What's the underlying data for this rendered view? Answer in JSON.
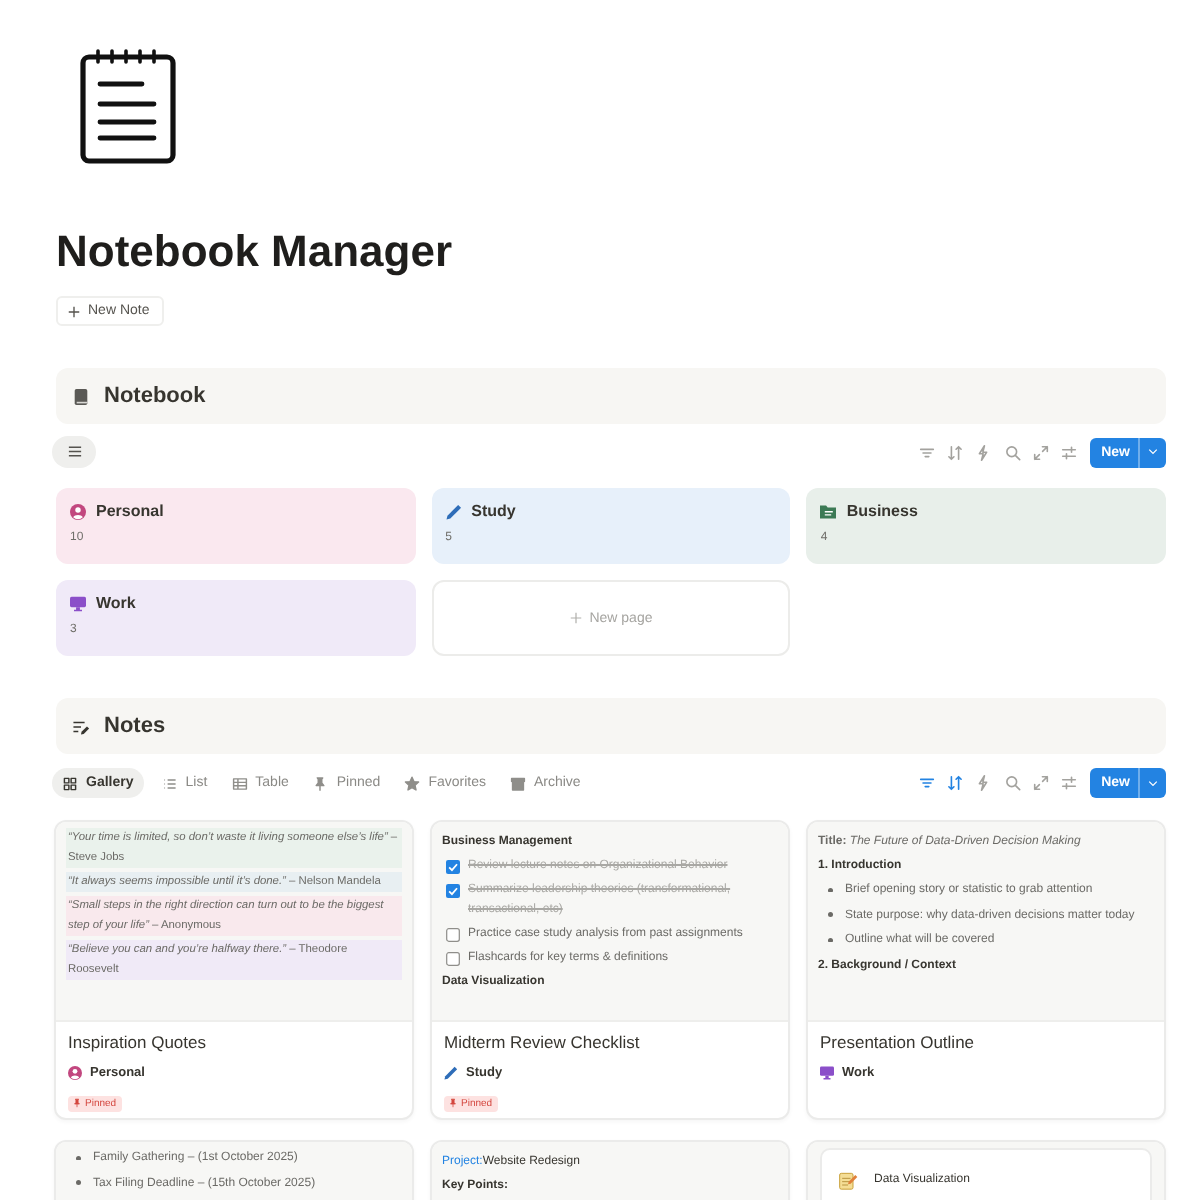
{
  "header": {
    "title": "Notebook Manager",
    "new_note": "New Note"
  },
  "notebook": {
    "title": "Notebook",
    "toolbar": {
      "filter_active": false,
      "sort_active": false,
      "new_label": "New"
    },
    "categories": [
      {
        "kind": "personal",
        "name": "Personal",
        "count": "10",
        "color": "#fae8ef"
      },
      {
        "kind": "study",
        "name": "Study",
        "count": "5",
        "color": "#e7f0fa"
      },
      {
        "kind": "business",
        "name": "Business",
        "count": "4",
        "color": "#e8efea"
      },
      {
        "kind": "work",
        "name": "Work",
        "count": "3",
        "color": "#f0eaf8"
      }
    ],
    "new_page": "New page"
  },
  "notes": {
    "title": "Notes",
    "tabs": [
      {
        "label": "Gallery",
        "selected": true
      },
      {
        "label": "List",
        "selected": false
      },
      {
        "label": "Table",
        "selected": false
      },
      {
        "label": "Pinned",
        "selected": false
      },
      {
        "label": "Favorites",
        "selected": false
      },
      {
        "label": "Archive",
        "selected": false
      }
    ],
    "toolbar": {
      "filter_active": true,
      "sort_active": true,
      "new_label": "New"
    },
    "cards": [
      {
        "lines": [
          {
            "kind": "quote",
            "text": "*“Your time is limited, so don’t waste it living someone else’s life”* – Steve Jobs",
            "color": "#eaf2ec"
          },
          {
            "kind": "quote",
            "text": "*“It always seems impossible until it’s done.”* – Nelson Mandela",
            "color": "#e8eff2"
          },
          {
            "kind": "quote",
            "text": "*“Small steps in the right direction can turn out to be the biggest step of your life”* – Anonymous",
            "color": "#f9e9ed"
          },
          {
            "kind": "quote",
            "text": "*“Believe you can and you’re halfway there.”* – Theodore Roosevelt",
            "color": "#f0eaf7"
          }
        ],
        "title": "Inspiration Quotes",
        "category": {
          "kind": "personal",
          "name": "Personal"
        },
        "badge": "Pinned"
      },
      {
        "lines": [
          {
            "kind": "heading",
            "text": "Business Management"
          },
          {
            "kind": "todo",
            "text": "Review lecture notes on Organizational Behavior",
            "checked": true
          },
          {
            "kind": "todo",
            "text": "Summarize leadership theories (transformational, transactional, etc)",
            "checked": true
          },
          {
            "kind": "todo",
            "text": "Practice case study analysis from past assignments",
            "checked": false
          },
          {
            "kind": "todo",
            "text": "Flashcards for key terms & definitions",
            "checked": false
          },
          {
            "kind": "heading",
            "text": "Data Visualization"
          }
        ],
        "title": "Midterm Review Checklist",
        "category": {
          "kind": "study",
          "name": "Study"
        },
        "badge": "Pinned"
      },
      {
        "lines": [
          {
            "kind": "para",
            "text": "**Title:** *The Future of Data-Driven Decision Making*"
          },
          {
            "kind": "heading",
            "text": "1. Introduction"
          },
          {
            "kind": "bullet",
            "text": "Brief opening story or statistic to grab attention"
          },
          {
            "kind": "bullet",
            "text": "State purpose: why data-driven decisions matter today"
          },
          {
            "kind": "bullet",
            "text": "Outline what will be covered"
          },
          {
            "kind": "heading",
            "text": "2. Background / Context"
          }
        ],
        "title": "Presentation Outline",
        "category": {
          "kind": "work",
          "name": "Work"
        }
      },
      {
        "lines": [
          {
            "kind": "bullet",
            "text": "Family Gathering – (1st October 2025)"
          },
          {
            "kind": "bullet",
            "text": "Tax Filing Deadline – (15th October 2025)"
          }
        ]
      },
      {
        "lines": [
          {
            "kind": "field",
            "label": "Project:",
            "text": "Website Redesign"
          },
          {
            "kind": "heading",
            "text": "Key Points:"
          }
        ]
      },
      {
        "lines": [
          {
            "kind": "embed",
            "text": "Data Visualization"
          }
        ]
      }
    ]
  }
}
